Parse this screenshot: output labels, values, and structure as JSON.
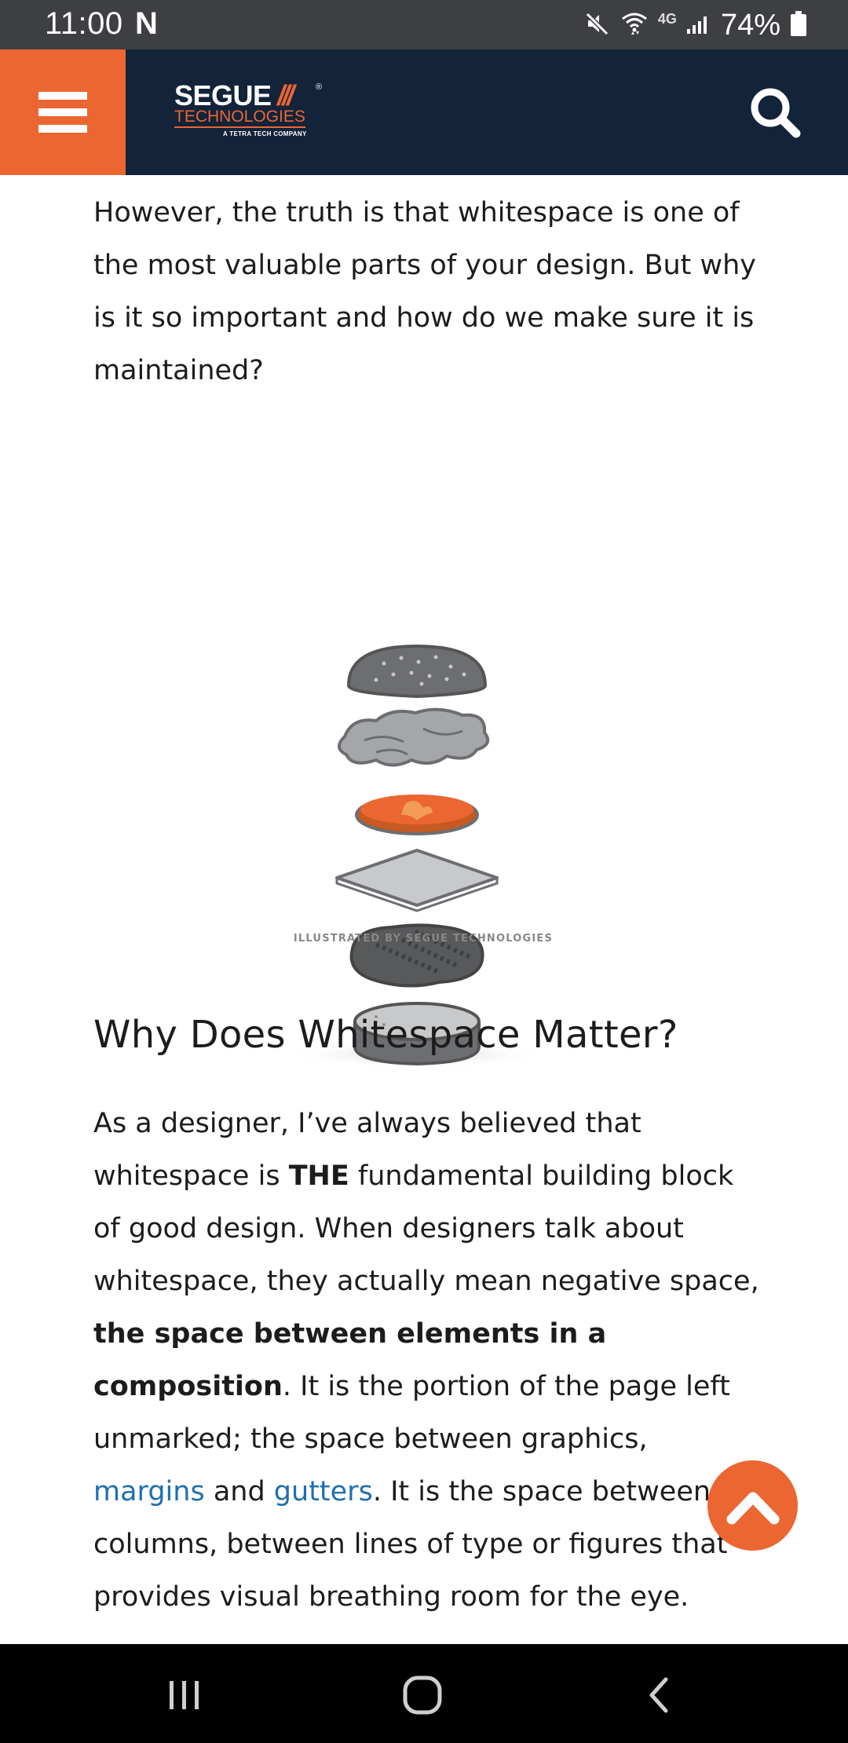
{
  "status_bar": {
    "time": "11:00",
    "notification_letter": "N",
    "network_label": "4G",
    "battery_percent": "74%",
    "icons": [
      "mute-icon",
      "wifi-icon",
      "signal-icon",
      "battery-icon"
    ]
  },
  "header": {
    "logo": {
      "brand_word": "SEGUE",
      "brand_mark": "///",
      "registered": "®",
      "brand_line2": "TECHNOLOGIES",
      "tagline": "A TETRA TECH COMPANY"
    },
    "menu_icon": "hamburger-icon",
    "search_icon": "search-icon",
    "colors": {
      "header_bg": "#12233a",
      "accent": "#ec6631"
    }
  },
  "article": {
    "intro_paragraph": "However, the truth is that whitespace is one of the most valuable parts of your design. But why is it so important and how do we make sure it is maintained?",
    "illustration_caption": "ILLUSTRATED BY SEGUE TECHNOLOGIES",
    "section_heading": "Why Does Whitespace Matter?",
    "body": {
      "part1": "As a designer, I’ve always believed that whitespace is ",
      "bold1": "THE",
      "part2": " fundamental building block of good design. When designers talk about whitespace, they actually mean negative space, ",
      "bold2": "the space between elements in a composition",
      "part3": ". It is the portion of the page left unmarked; the space between graphics, ",
      "link1": "margins",
      "part4": " and ",
      "link2": "gutters",
      "part5": ". It is the space between columns, between lines of type or figures that provides visual breathing room for the eye."
    },
    "link_color": "#1f6fb0"
  },
  "scroll_top": {
    "icon": "chevron-up-icon"
  },
  "nav_bar": {
    "icons": [
      "recent-apps-icon",
      "home-icon",
      "back-icon"
    ]
  }
}
